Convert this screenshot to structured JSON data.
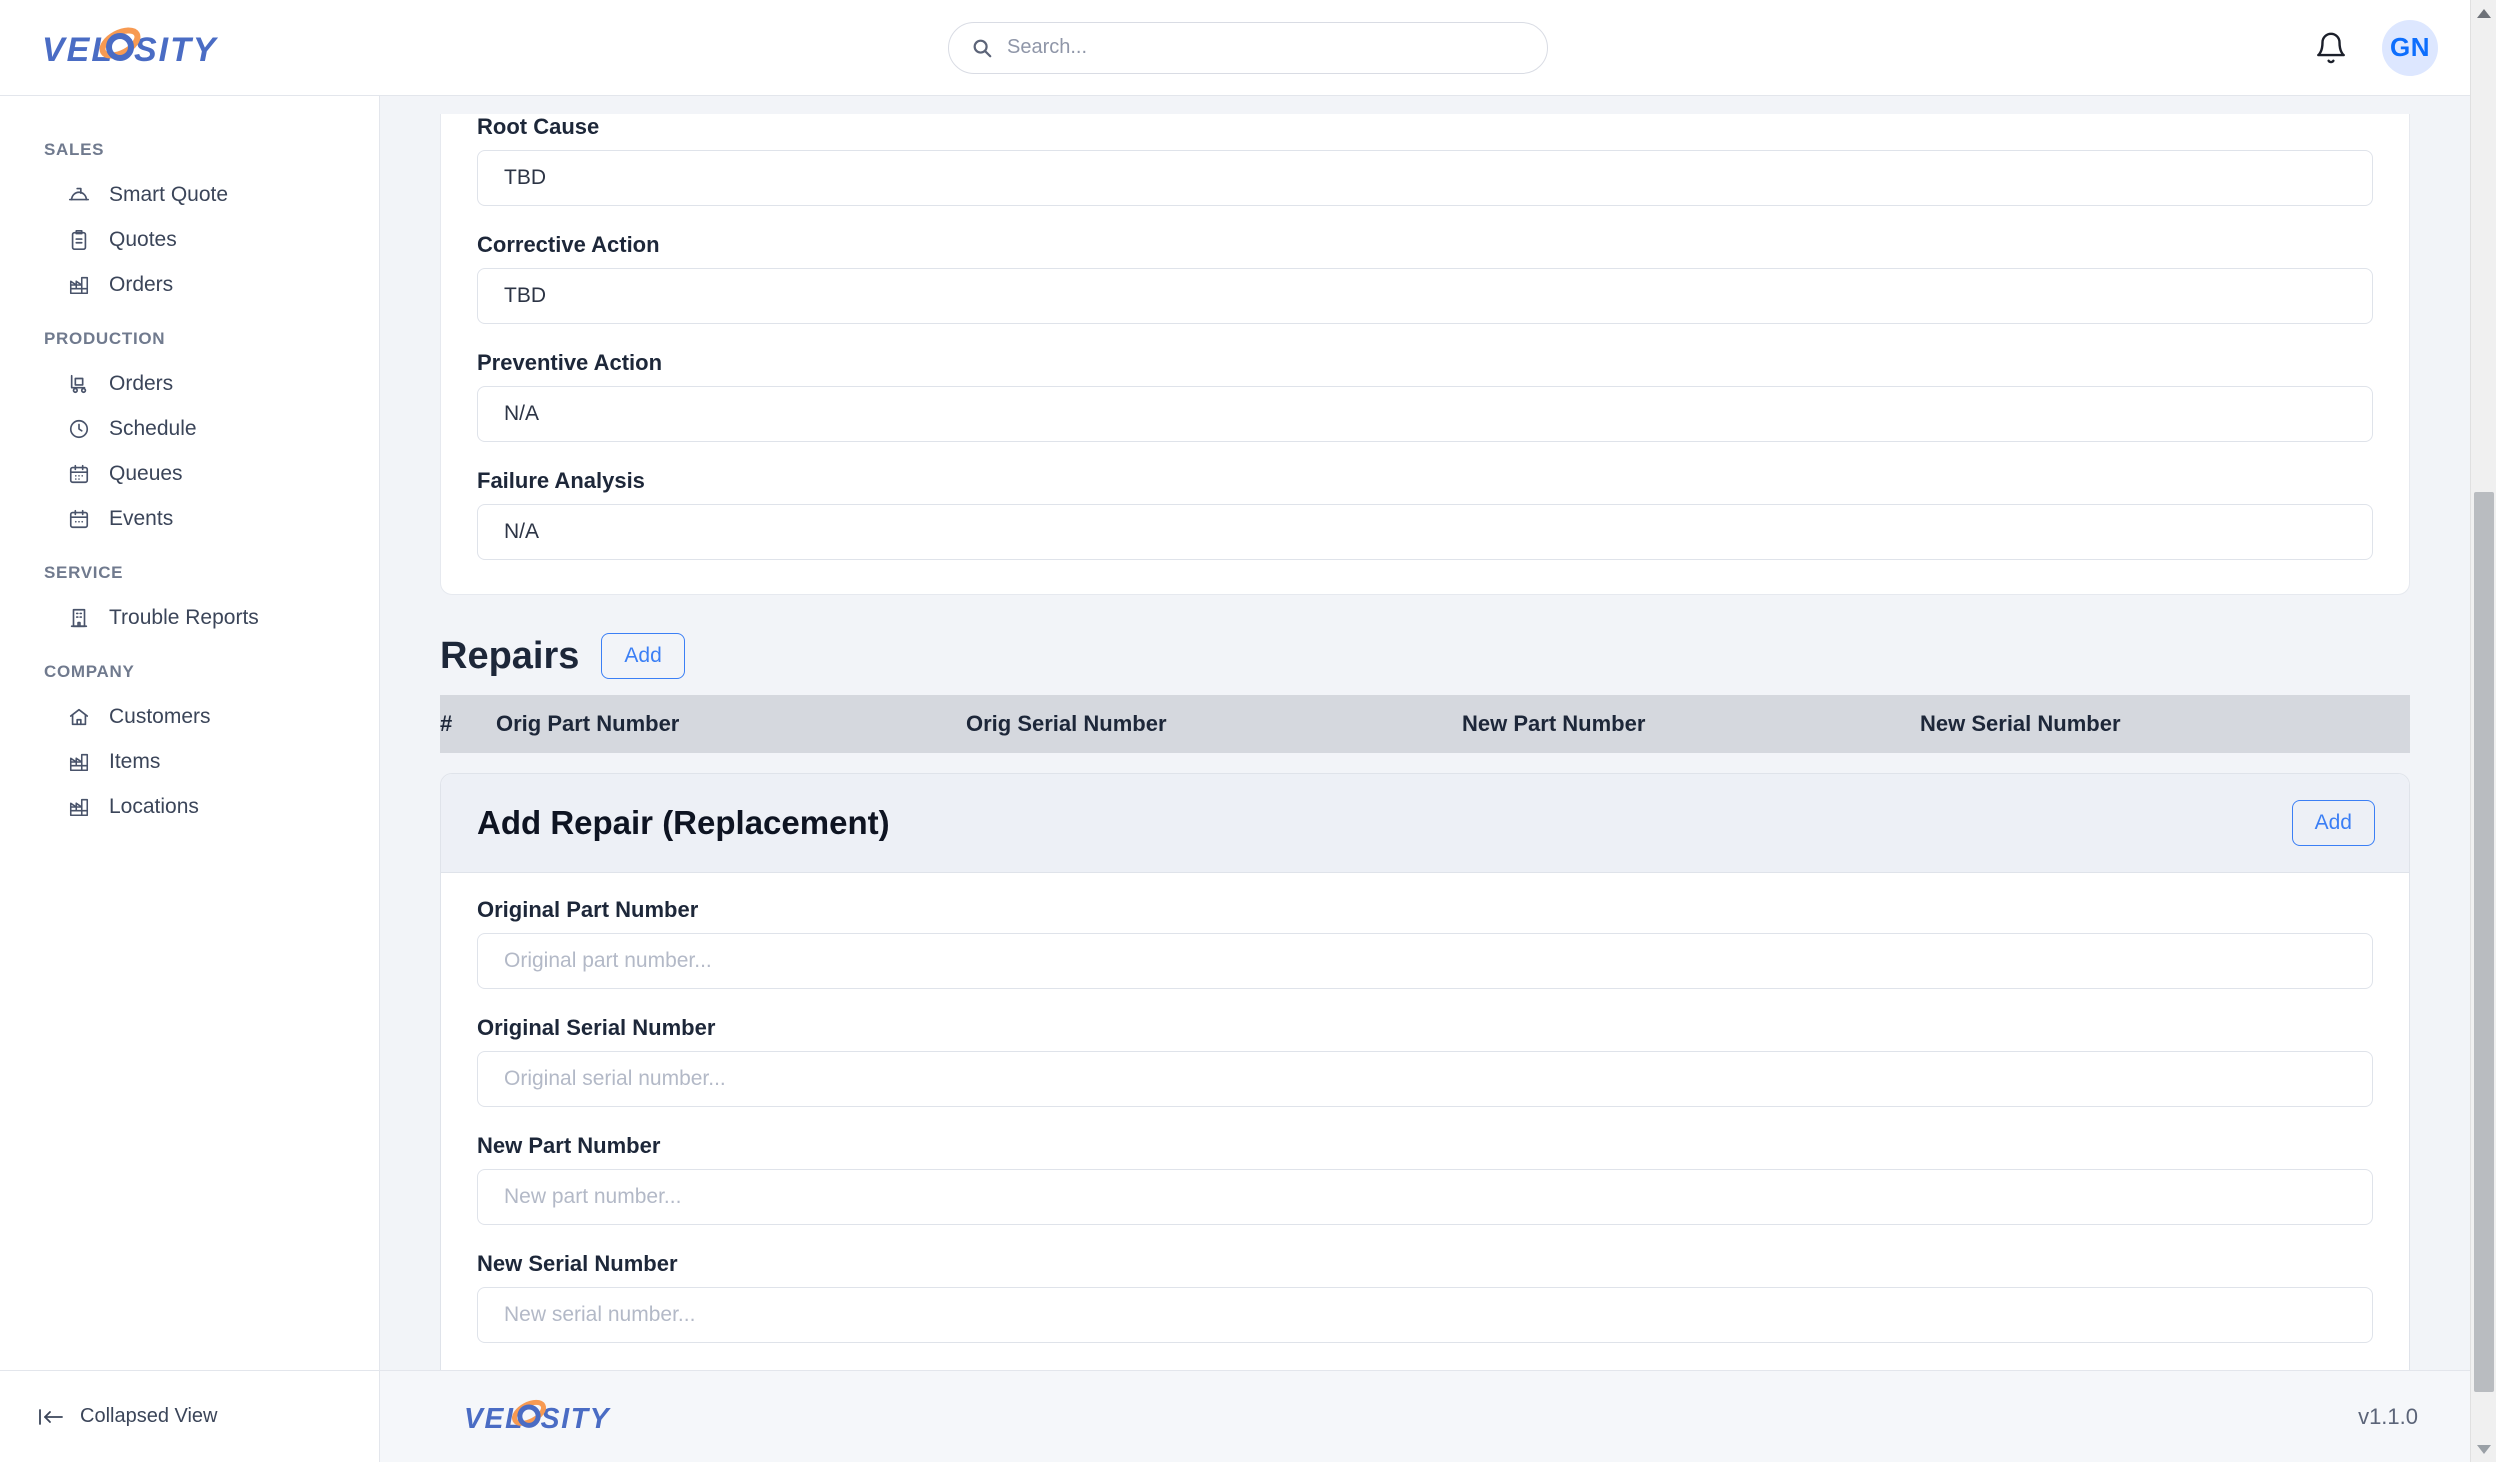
{
  "brand": {
    "name": "VELOSITY"
  },
  "header": {
    "search": {
      "value": "",
      "placeholder": "Search..."
    },
    "notifications_icon": "bell-icon",
    "avatar_initials": "GN"
  },
  "sidebar": {
    "groups": [
      {
        "label": "SALES",
        "items": [
          {
            "label": "Smart Quote",
            "icon": "hard-hat-icon"
          },
          {
            "label": "Quotes",
            "icon": "clipboard-icon"
          },
          {
            "label": "Orders",
            "icon": "factory-icon"
          }
        ]
      },
      {
        "label": "PRODUCTION",
        "items": [
          {
            "label": "Orders",
            "icon": "dolly-icon"
          },
          {
            "label": "Schedule",
            "icon": "clock-icon"
          },
          {
            "label": "Queues",
            "icon": "calendar-grid-icon"
          },
          {
            "label": "Events",
            "icon": "calendar-icon"
          }
        ]
      },
      {
        "label": "SERVICE",
        "items": [
          {
            "label": "Trouble Reports",
            "icon": "building-icon"
          }
        ]
      },
      {
        "label": "COMPANY",
        "items": [
          {
            "label": "Customers",
            "icon": "home-icon"
          },
          {
            "label": "Items",
            "icon": "factory-icon"
          },
          {
            "label": "Locations",
            "icon": "factory-icon"
          }
        ]
      }
    ],
    "footer": {
      "label": "Collapsed View",
      "icon": "collapse-left-icon"
    }
  },
  "main": {
    "fields": [
      {
        "label": "Root Cause",
        "value": "TBD",
        "placeholder": ""
      },
      {
        "label": "Corrective Action",
        "value": "TBD",
        "placeholder": ""
      },
      {
        "label": "Preventive Action",
        "value": "N/A",
        "placeholder": ""
      },
      {
        "label": "Failure Analysis",
        "value": "N/A",
        "placeholder": ""
      }
    ],
    "repairs": {
      "title": "Repairs",
      "add_label": "Add",
      "columns": [
        "#",
        "Orig Part Number",
        "Orig Serial Number",
        "New Part Number",
        "New Serial Number"
      ],
      "rows": []
    },
    "add_repair": {
      "title": "Add Repair (Replacement)",
      "add_label": "Add",
      "fields": [
        {
          "label": "Original Part Number",
          "value": "",
          "placeholder": "Original part number..."
        },
        {
          "label": "Original Serial Number",
          "value": "",
          "placeholder": "Original serial number..."
        },
        {
          "label": "New Part Number",
          "value": "",
          "placeholder": "New part number..."
        },
        {
          "label": "New Serial Number",
          "value": "",
          "placeholder": "New serial number..."
        }
      ]
    }
  },
  "footer": {
    "version": "v1.1.0"
  },
  "colors": {
    "accent": "#3b7ff5",
    "avatar_text": "#0d6efd",
    "avatar_bg": "#dde7ff",
    "logo_blue": "#4a6cc4",
    "logo_orange": "#f79a52",
    "page_bg": "#f2f4f8",
    "table_header_bg": "#d5d8de"
  }
}
